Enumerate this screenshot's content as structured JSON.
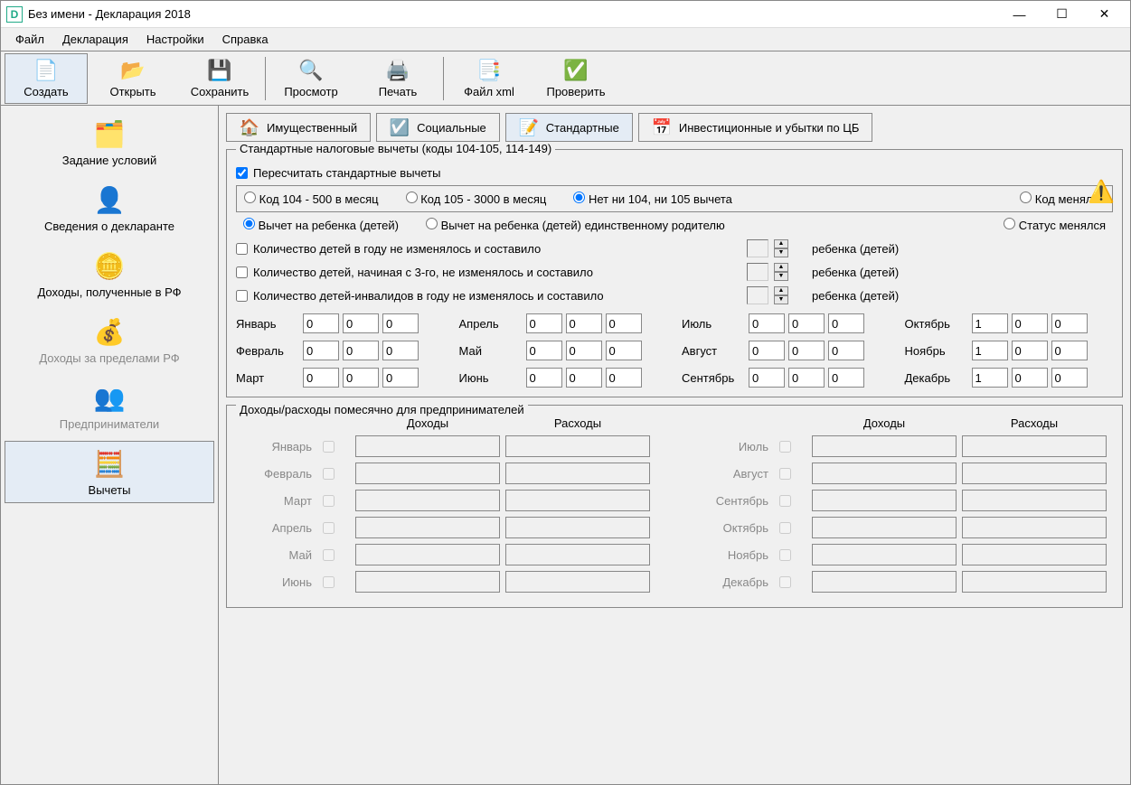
{
  "window": {
    "title": "Без имени - Декларация 2018"
  },
  "menu": {
    "file": "Файл",
    "decl": "Декларация",
    "settings": "Настройки",
    "help": "Справка"
  },
  "toolbar": {
    "create": "Создать",
    "open": "Открыть",
    "save": "Сохранить",
    "preview": "Просмотр",
    "print": "Печать",
    "xml": "Файл xml",
    "check": "Проверить"
  },
  "sidebar": {
    "conditions": "Задание условий",
    "declarant": "Сведения о декларанте",
    "income_rf": "Доходы, полученные в РФ",
    "income_abroad": "Доходы за пределами РФ",
    "entrepreneurs": "Предприниматели",
    "deductions": "Вычеты"
  },
  "tabs": {
    "property": "Имущественный",
    "social": "Социальные",
    "standard": "Стандартные",
    "invest": "Инвестиционные и убытки по ЦБ"
  },
  "std": {
    "group_title": "Стандартные налоговые вычеты (коды 104-105, 114-149)",
    "recalc": "Пересчитать стандартные вычеты",
    "code104": "Код 104 - 500 в месяц",
    "code105": "Код 105 - 3000 в месяц",
    "no104105": "Нет ни 104, ни 105 вычета",
    "code_changed": "Код менялся",
    "child": "Вычет на ребенка (детей)",
    "single_parent": "Вычет на ребенка (детей) единственному родителю",
    "status_changed": "Статус менялся",
    "kids_const": "Количество детей в году не изменялось и составило",
    "kids_from3": "Количество детей, начиная с 3-го, не изменялось и составило",
    "kids_disabled": "Количество детей-инвалидов в году не изменялось и составило",
    "unit": "ребенка (детей)"
  },
  "months": {
    "jan": "Январь",
    "feb": "Февраль",
    "mar": "Март",
    "apr": "Апрель",
    "may": "Май",
    "jun": "Июнь",
    "jul": "Июль",
    "aug": "Август",
    "sep": "Сентябрь",
    "oct": "Октябрь",
    "nov": "Ноябрь",
    "dec": "Декабрь"
  },
  "month_values": {
    "jan": [
      "0",
      "0",
      "0"
    ],
    "feb": [
      "0",
      "0",
      "0"
    ],
    "mar": [
      "0",
      "0",
      "0"
    ],
    "apr": [
      "0",
      "0",
      "0"
    ],
    "may": [
      "0",
      "0",
      "0"
    ],
    "jun": [
      "0",
      "0",
      "0"
    ],
    "jul": [
      "0",
      "0",
      "0"
    ],
    "aug": [
      "0",
      "0",
      "0"
    ],
    "sep": [
      "0",
      "0",
      "0"
    ],
    "oct": [
      "1",
      "0",
      "0"
    ],
    "nov": [
      "1",
      "0",
      "0"
    ],
    "dec": [
      "1",
      "0",
      "0"
    ]
  },
  "ie": {
    "title": "Доходы/расходы помесячно для предпринимателей",
    "income": "Доходы",
    "expense": "Расходы"
  }
}
